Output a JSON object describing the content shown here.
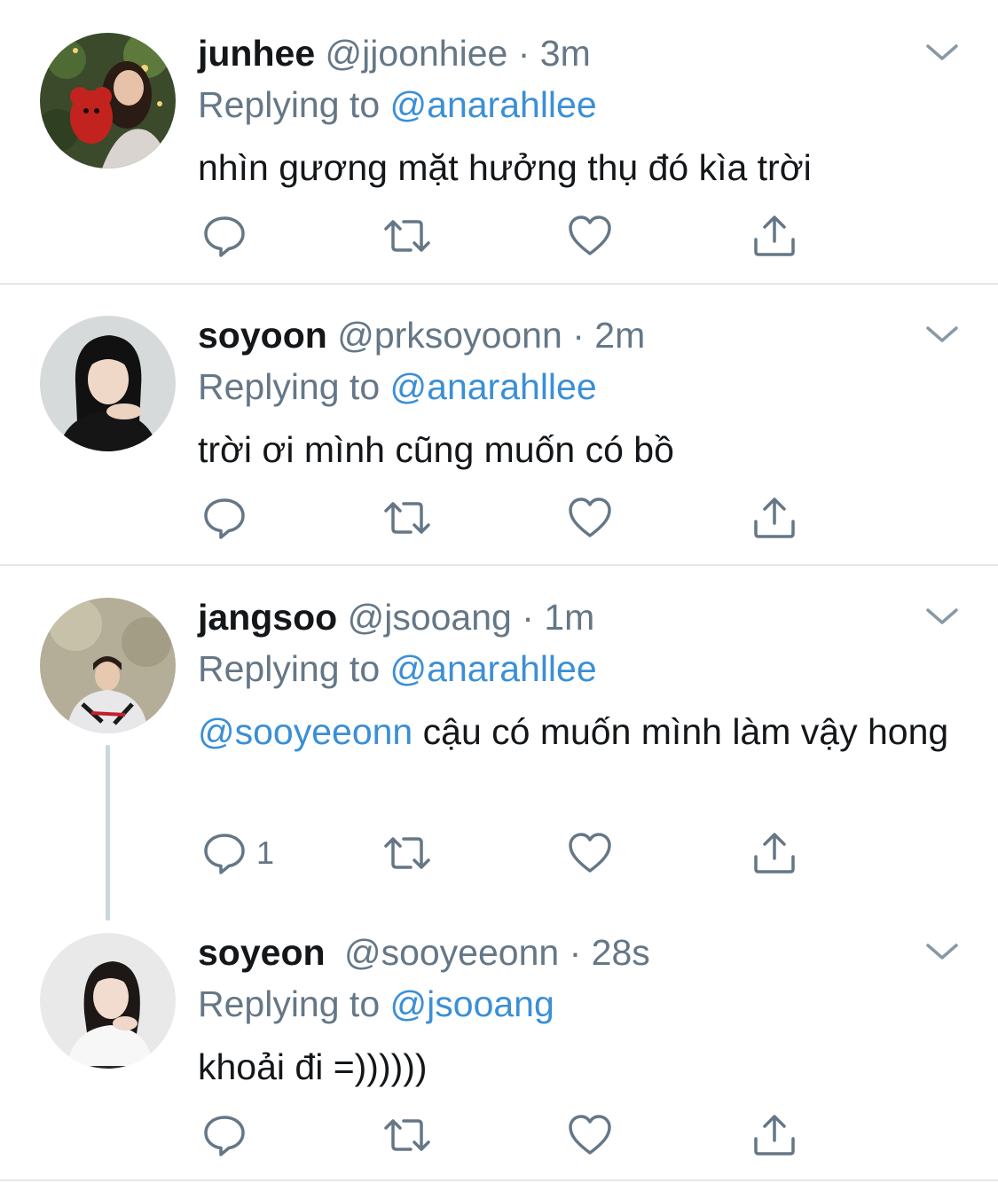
{
  "tweets": [
    {
      "name": "junhee",
      "handle": "@jjoonhiee",
      "dot": "·",
      "time": "3m",
      "replying_prefix": "Replying to",
      "replying_to": "@anarahllee",
      "mention": "",
      "text": "nhìn gương mặt hưởng thụ đó kìa trời",
      "reply_count": ""
    },
    {
      "name": "soyoon",
      "handle": "@prksoyoonn",
      "dot": "·",
      "time": "2m",
      "replying_prefix": "Replying to",
      "replying_to": "@anarahllee",
      "mention": "",
      "text": "trời ơi mình cũng muốn có bồ",
      "reply_count": ""
    },
    {
      "name": "jangsoo",
      "handle": "@jsooang",
      "dot": "·",
      "time": "1m",
      "replying_prefix": "Replying to",
      "replying_to": "@anarahllee",
      "mention": "@sooyeeonn",
      "text": " cậu có muốn mình làm vậy hong",
      "reply_count": "1"
    },
    {
      "name": "soyeon",
      "handle": "@sooyeeonn",
      "dot": "·",
      "time": "28s",
      "replying_prefix": "Replying to",
      "replying_to": "@jsooang",
      "mention": "",
      "text": "khoải đi =))))))",
      "reply_count": ""
    }
  ],
  "icons": {
    "reply": "reply-icon",
    "retweet": "retweet-icon",
    "like": "heart-icon",
    "share": "share-icon",
    "caret": "chevron-down-icon"
  },
  "colors": {
    "text": "#14171a",
    "secondary": "#657786",
    "link": "#3b8fd6",
    "divider": "#e1e8ed",
    "thread_line": "#ccd6dd"
  }
}
